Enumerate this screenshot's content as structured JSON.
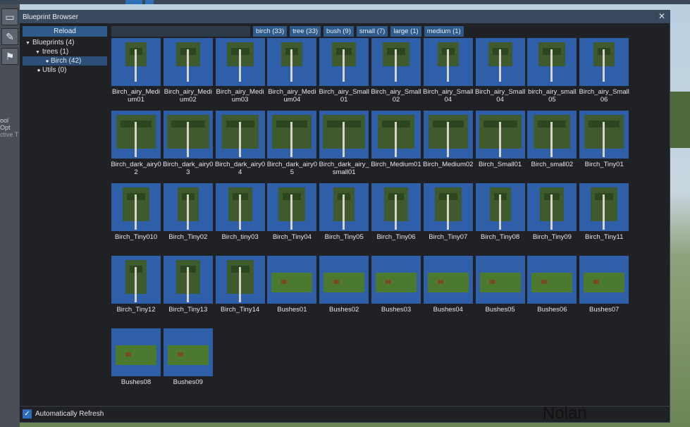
{
  "window": {
    "title": "Blueprint Browser"
  },
  "toolbar": {
    "reload_label": "Reload"
  },
  "search": {
    "value": ""
  },
  "sidebar_fragments": [
    "ool Opt",
    "ctive T"
  ],
  "tree": [
    {
      "label": "Blueprints (4)",
      "level": 0,
      "expanded": true
    },
    {
      "label": "trees (1)",
      "level": 1,
      "expanded": true
    },
    {
      "label": "Birch (42)",
      "level": 2,
      "selected": true
    },
    {
      "label": "Utils (0)",
      "level": 1
    }
  ],
  "tags": [
    "birch (33)",
    "tree (33)",
    "bush (9)",
    "small (7)",
    "large (1)",
    "medium (1)"
  ],
  "items": [
    "Birch_airy_Medium01",
    "Birch_airy_Medium02",
    "Birch_airy_Medium03",
    "Birch_airy_Medium04",
    "Birch_airy_Small01",
    "Birch_airy_Small02",
    "Birch_airy_Small04",
    "Birch_airy_Small04",
    "birch_airy_small05",
    "Birch_airy_Small06",
    "Birch_dark_airy02",
    "Birch_dark_airy03",
    "Birch_dark_airy04",
    "Birch_dark_airy05",
    "Birch_dark_airy_small01",
    "Birch_Medium01",
    "Birch_Medium02",
    "Birch_Small01",
    "Birch_small02",
    "Birch_Tiny01",
    "Birch_Tiny010",
    "Birch_Tiny02",
    "Birch_tiny03",
    "Birch_Tiny04",
    "Birch_Tiny05",
    "Birch_Tiny06",
    "Birch_Tiny07",
    "Birch_Tiny08",
    "Birch_Tiny09",
    "Birch_Tiny11",
    "Birch_Tiny12",
    "Birch_Tiny13",
    "Birch_Tiny14",
    "Bushes01",
    "Bushes02",
    "Bushes03",
    "Bushes04",
    "Bushes05",
    "Bushes06",
    "Bushes07",
    "Bushes08",
    "Bushes09"
  ],
  "footer": {
    "auto_refresh_label": "Automatically Refresh",
    "auto_refresh_checked": true
  },
  "watermark": "Nolan",
  "colors": {
    "accent": "#2e5a8c",
    "thumb_bg": "#2f5fa8",
    "panel_bg": "#202124"
  }
}
